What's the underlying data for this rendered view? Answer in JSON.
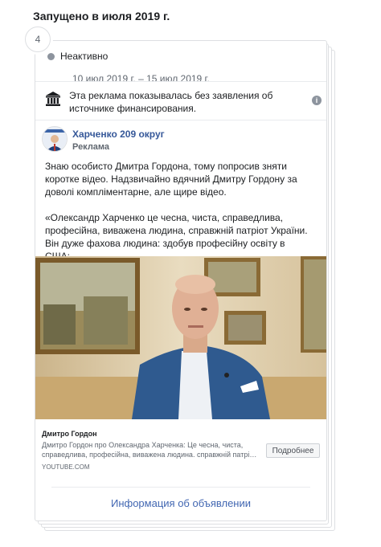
{
  "heading": "Запущено в июля 2019 г.",
  "ad_count": "4",
  "status": {
    "label": "Неактивно",
    "date_range": "10 июл 2019 г. – 15 июл 2019 г."
  },
  "disclaimer": {
    "text": "Эта реклама показывалась без заявления об источнике финансирования.",
    "icon": "bank-icon"
  },
  "ad": {
    "page_name": "Харченко 209 округ",
    "sponsored_label": "Реклама",
    "body_paragraph_1": "Знаю особисто Дмитра Гордона, тому попросив зняти коротке відео. Надзвичайно вдячний Дмитру Гордону за доволі компліментарне, але щире відео.",
    "body_paragraph_2": "«Олександр Харченко це чесна, чиста, справедлива, професійна, виважена людина, справжній патріот України. Він дуже фахова людина: здобув професійну освіту в США;…",
    "link_title": "Дмитро Гордон",
    "link_description": "Дмитро Гордон про Олександра Харченка: Це чесна, чиста, справедлива, професійна, виважена людина. справжній патрі…",
    "link_domain": "YOUTUBE.COM",
    "cta_label": "Подробнее"
  },
  "footer_link": "Информация об объявлении",
  "colors": {
    "link_blue": "#4267b2",
    "page_name": "#365899",
    "jacket": "#2f5a8f",
    "border": "#dddfe2"
  }
}
